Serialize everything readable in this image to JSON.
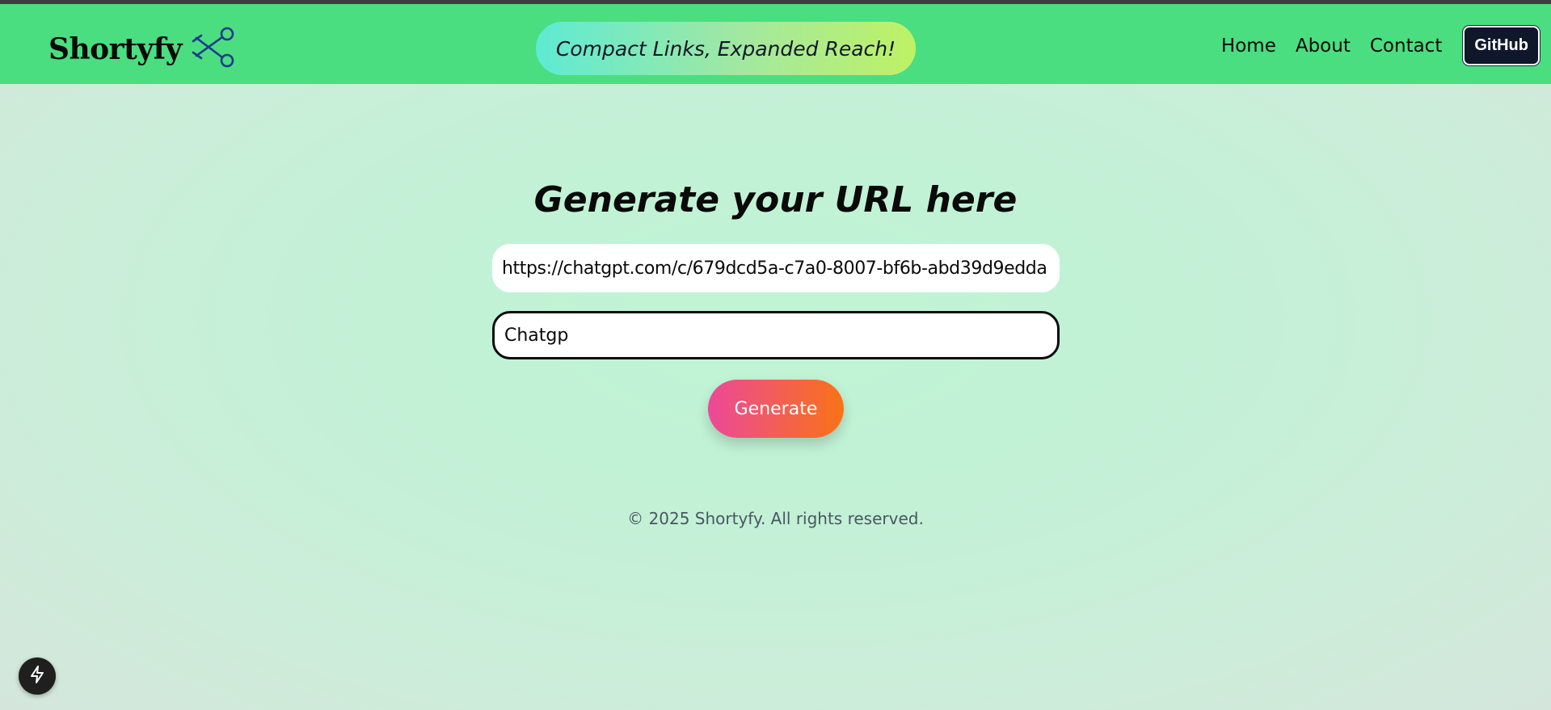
{
  "header": {
    "brand": "Shortyfy",
    "logo_icon": "scissors-icon",
    "tagline": "Compact Links, Expanded Reach!",
    "nav": [
      "Home",
      "About",
      "Contact"
    ],
    "github_label": "GitHub"
  },
  "main": {
    "heading": "Generate your URL here",
    "url_value": "https://chatgpt.com/c/679dcd5a-c7a0-8007-bf6b-abd39d9edda",
    "alias_value": "Chatgp",
    "generate_label": "Generate"
  },
  "footer": {
    "copyright": "© 2025 Shortyfy. All rights reserved."
  },
  "corner_button": {
    "icon": "lightning-icon"
  },
  "colors": {
    "navbar": "#4ade80",
    "tagline_gradient": [
      "#5eead4",
      "#bef264"
    ],
    "generate_gradient": [
      "#ec4899",
      "#f97316"
    ],
    "github_bg": "#0f172a"
  }
}
